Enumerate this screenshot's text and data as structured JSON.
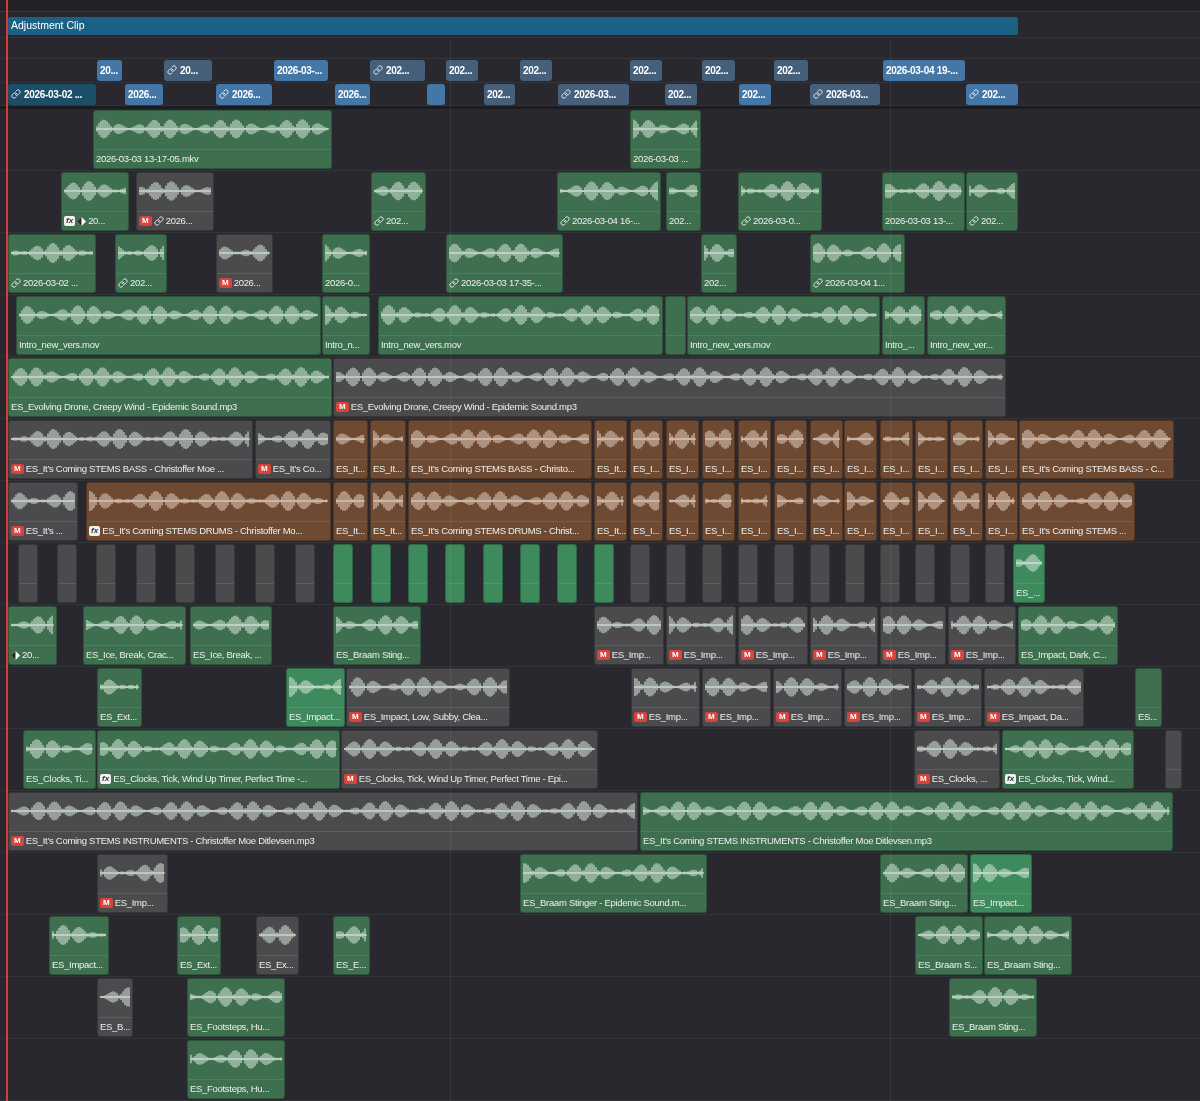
{
  "timeline": {
    "adjustment_clip": {
      "label": "Adjustment Clip"
    },
    "title_tracks": [
      {
        "clips": [
          {
            "label": "20...",
            "color": "#4577a6",
            "linked": false
          },
          {
            "label": "20...",
            "color": "#46607c",
            "linked": true
          },
          {
            "label": "2026-03-...",
            "color": "#4577a6",
            "linked": false
          },
          {
            "label": "202...",
            "color": "#46607c",
            "linked": true
          },
          {
            "label": "202...",
            "color": "#46607c",
            "linked": false
          },
          {
            "label": "202...",
            "color": "#46607c",
            "linked": false
          },
          {
            "label": "202...",
            "color": "#46607c",
            "linked": false
          },
          {
            "label": "202...",
            "color": "#46607c",
            "linked": false
          },
          {
            "label": "202...",
            "color": "#46607c",
            "linked": false
          },
          {
            "label": "2026-03-04 19-...",
            "color": "#4577a6",
            "linked": false
          }
        ]
      },
      {
        "clips": [
          {
            "label": "2026-03-02 ...",
            "color": "#1c4e68",
            "linked": true
          },
          {
            "label": "2026...",
            "color": "#4577a6",
            "linked": false
          },
          {
            "label": "2026...",
            "color": "#4577a6",
            "linked": true
          },
          {
            "label": "2026...",
            "color": "#4577a6",
            "linked": false
          },
          {
            "color": "#4577a6",
            "linked": false
          },
          {
            "label": "202...",
            "color": "#46607c",
            "linked": false
          },
          {
            "label": "2026-03...",
            "color": "#46607c",
            "linked": true
          },
          {
            "label": "202...",
            "color": "#46607c",
            "linked": false
          },
          {
            "label": "202...",
            "color": "#4577a6",
            "linked": false
          },
          {
            "label": "2026-03...",
            "color": "#46607c",
            "linked": true
          },
          {
            "label": "202...",
            "color": "#4577a6",
            "linked": true
          }
        ]
      }
    ],
    "tracks": [
      {
        "clips": [
          {
            "label": "2026-03-03 13-17-05.mkv",
            "color": "#3e7050",
            "linked": false
          },
          {
            "label": "2026-03-03 ...",
            "color": "#3e7050",
            "linked": false
          }
        ]
      },
      {
        "clips": [
          {
            "label": "20...",
            "color": "#3e7050",
            "linked": false,
            "fx_badge": "fx",
            "keyframed": true
          },
          {
            "label": "2026...",
            "color": "#4b4b4e",
            "linked": true,
            "mute_badge": "M",
            "keyframed": false
          },
          {
            "label": "202...",
            "color": "#3e7050",
            "linked": true,
            "keyframed": false
          },
          {
            "label": "2026-03-04 16-...",
            "color": "#3e7050",
            "linked": true,
            "keyframed": false
          },
          {
            "label": "202...",
            "color": "#3e7050",
            "linked": false,
            "keyframed": false
          },
          {
            "label": "2026-03-0...",
            "color": "#3e7050",
            "linked": true,
            "keyframed": false
          },
          {
            "label": "2026-03-03 13-...",
            "color": "#3e7050",
            "linked": false,
            "keyframed": false
          },
          {
            "label": "202...",
            "color": "#3e7050",
            "linked": true,
            "keyframed": false
          }
        ]
      },
      {
        "clips": [
          {
            "label": "2026-03-02 ...",
            "color": "#3e7050",
            "linked": true
          },
          {
            "label": "202...",
            "color": "#3e7050",
            "linked": true
          },
          {
            "label": "2026...",
            "color": "#4b4b4e",
            "linked": false,
            "mute_badge": "M"
          },
          {
            "label": "2026-0...",
            "color": "#3e7050",
            "linked": false
          },
          {
            "label": "2026-03-03 17-35-...",
            "color": "#3e7050",
            "linked": true
          },
          {
            "label": "202...",
            "color": "#3e7050",
            "linked": false
          },
          {
            "label": "2026-03-04 1...",
            "color": "#3e7050",
            "linked": true
          }
        ]
      },
      {
        "clips": [
          {
            "label": "Intro_new_vers.mov",
            "color": "#3e7050"
          },
          {
            "label": "Intro_n...",
            "color": "#3e7050"
          },
          {
            "label": "Intro_new_vers.mov",
            "color": "#3e7050"
          },
          {
            "color": "#3e7050"
          },
          {
            "label": "Intro_new_vers.mov",
            "color": "#3e7050"
          },
          {
            "label": "Intro_...",
            "color": "#3e7050"
          },
          {
            "label": "Intro_new_ver...",
            "color": "#3e7050"
          }
        ]
      },
      {
        "clips": [
          {
            "label": "ES_Evolving Drone, Creepy Wind - Epidemic Sound.mp3",
            "color": "#3e7050"
          },
          {
            "label": "ES_Evolving Drone, Creepy Wind - Epidemic Sound.mp3",
            "color": "#4b4b4e",
            "mute_badge": "M"
          }
        ]
      },
      {
        "clips": [
          {
            "label": "ES_It’s Coming STEMS BASS - Christoffer Moe ...",
            "color": "#4b4b4e",
            "mute_badge": "M"
          },
          {
            "label": "ES_It’s Co...",
            "color": "#4b4b4e",
            "mute_badge": "M"
          },
          {
            "label": "ES_It...",
            "color": "#6e4a33"
          },
          {
            "label": "ES_It...",
            "color": "#6e4a33"
          },
          {
            "label": "ES_It’s Coming STEMS BASS - Christo...",
            "color": "#6e4a33"
          },
          {
            "label": "ES_It...",
            "color": "#6e4a33"
          },
          {
            "label": "ES_I...",
            "color": "#6e4a33"
          },
          {
            "label": "ES_I...",
            "color": "#6e4a33"
          },
          {
            "label": "ES_I...",
            "color": "#6e4a33"
          },
          {
            "label": "ES_I...",
            "color": "#6e4a33"
          },
          {
            "label": "ES_I...",
            "color": "#6e4a33"
          },
          {
            "label": "ES_I...",
            "color": "#6e4a33"
          },
          {
            "label": "ES_I...",
            "color": "#6e4a33"
          },
          {
            "label": "ES_I...",
            "color": "#6e4a33"
          },
          {
            "label": "ES_I...",
            "color": "#6e4a33"
          },
          {
            "label": "ES_I...",
            "color": "#6e4a33"
          },
          {
            "label": "ES_I...",
            "color": "#6e4a33"
          },
          {
            "label": "ES_It’s Coming STEMS BASS - C...",
            "color": "#6e4a33"
          }
        ]
      },
      {
        "clips": [
          {
            "label": "ES_It’s ...",
            "color": "#4b4b4e",
            "mute_badge": "M"
          },
          {
            "label": "ES_It’s Coming STEMS DRUMS - Christoffer Mo...",
            "color": "#6e4a33",
            "fx_badge": "fx"
          },
          {
            "label": "ES_It...",
            "color": "#6e4a33"
          },
          {
            "label": "ES_It...",
            "color": "#6e4a33"
          },
          {
            "label": "ES_It’s Coming STEMS DRUMS - Christ...",
            "color": "#6e4a33"
          },
          {
            "label": "ES_It...",
            "color": "#6e4a33"
          },
          {
            "label": "ES_I...",
            "color": "#6e4a33"
          },
          {
            "label": "ES_I...",
            "color": "#6e4a33"
          },
          {
            "label": "ES_I...",
            "color": "#6e4a33"
          },
          {
            "label": "ES_I...",
            "color": "#6e4a33"
          },
          {
            "label": "ES_I...",
            "color": "#6e4a33"
          },
          {
            "label": "ES_I...",
            "color": "#6e4a33"
          },
          {
            "label": "ES_I...",
            "color": "#6e4a33"
          },
          {
            "label": "ES_I...",
            "color": "#6e4a33"
          },
          {
            "label": "ES_I...",
            "color": "#6e4a33"
          },
          {
            "label": "ES_I...",
            "color": "#6e4a33"
          },
          {
            "label": "ES_I...",
            "color": "#6e4a33"
          },
          {
            "label": "ES_It’s Coming STEMS ...",
            "color": "#6e4a33"
          }
        ]
      },
      {
        "clips": [
          {
            "color": "#4b4b4e"
          },
          {
            "color": "#4b4b4e"
          },
          {
            "color": "#4b4b4e"
          },
          {
            "color": "#4b4b4e"
          },
          {
            "color": "#4b4b4e"
          },
          {
            "color": "#4b4b4e"
          },
          {
            "color": "#4b4b4e"
          },
          {
            "color": "#4b4b4e"
          },
          {
            "color": "#3e8a5c"
          },
          {
            "color": "#3e8a5c"
          },
          {
            "color": "#3e8a5c"
          },
          {
            "color": "#3e8a5c"
          },
          {
            "color": "#3e8a5c"
          },
          {
            "color": "#3e8a5c"
          },
          {
            "color": "#3e8a5c"
          },
          {
            "color": "#3e8a5c"
          },
          {
            "color": "#4b4b4e"
          },
          {
            "color": "#4b4b4e"
          },
          {
            "color": "#4b4b4e"
          },
          {
            "color": "#4b4b4e"
          },
          {
            "color": "#4b4b4e"
          },
          {
            "color": "#4b4b4e"
          },
          {
            "color": "#4b4b4e"
          },
          {
            "color": "#4b4b4e"
          },
          {
            "color": "#4b4b4e"
          },
          {
            "color": "#4b4b4e"
          },
          {
            "color": "#4b4b4e"
          },
          {
            "label": "ES_...",
            "color": "#3e8a5c"
          }
        ]
      },
      {
        "clips": [
          {
            "label": "20...",
            "color": "#3e7050",
            "keyframed": true
          },
          {
            "label": "ES_Ice, Break, Crac...",
            "color": "#3e7050",
            "keyframed": false
          },
          {
            "label": "ES_Ice, Break, ...",
            "color": "#3e7050",
            "keyframed": false
          },
          {
            "label": "ES_Braam Sting...",
            "color": "#3e7050",
            "keyframed": false
          },
          {
            "label": "ES_Imp...",
            "color": "#4b4b4e",
            "mute_badge": "M",
            "keyframed": false
          },
          {
            "label": "ES_Imp...",
            "color": "#4b4b4e",
            "mute_badge": "M",
            "keyframed": false
          },
          {
            "label": "ES_Imp...",
            "color": "#4b4b4e",
            "mute_badge": "M",
            "keyframed": false
          },
          {
            "label": "ES_Imp...",
            "color": "#4b4b4e",
            "mute_badge": "M",
            "keyframed": false
          },
          {
            "label": "ES_Imp...",
            "color": "#4b4b4e",
            "mute_badge": "M",
            "keyframed": false
          },
          {
            "label": "ES_Imp...",
            "color": "#4b4b4e",
            "mute_badge": "M",
            "keyframed": false
          },
          {
            "label": "ES_Impact, Dark, C...",
            "color": "#3e7050",
            "keyframed": false
          }
        ]
      },
      {
        "clips": [
          {
            "label": "ES_Ext...",
            "color": "#3e7050"
          },
          {
            "label": "ES_Impact...",
            "color": "#3e8a5c"
          },
          {
            "label": "ES_Impact, Low, Subby, Clea...",
            "color": "#4b4b4e",
            "mute_badge": "M"
          },
          {
            "label": "ES_Imp...",
            "color": "#4b4b4e",
            "mute_badge": "M"
          },
          {
            "label": "ES_Imp...",
            "color": "#4b4b4e",
            "mute_badge": "M"
          },
          {
            "label": "ES_Imp...",
            "color": "#4b4b4e",
            "mute_badge": "M"
          },
          {
            "label": "ES_Imp...",
            "color": "#4b4b4e",
            "mute_badge": "M"
          },
          {
            "label": "ES_Imp...",
            "color": "#4b4b4e",
            "mute_badge": "M"
          },
          {
            "label": "ES_Impact, Da...",
            "color": "#4b4b4e",
            "mute_badge": "M"
          },
          {
            "label": "ES...",
            "color": "#3e7050"
          }
        ]
      },
      {
        "clips": [
          {
            "label": "ES_Clocks, Ti...",
            "color": "#3e7050"
          },
          {
            "label": "ES_Clocks, Tick, Wind Up Timer, Perfect Time -...",
            "color": "#3e7050",
            "fx_badge": "fx"
          },
          {
            "label": "ES_Clocks, Tick, Wind Up Timer, Perfect Time - Epi...",
            "color": "#4b4b4e",
            "mute_badge": "M"
          },
          {
            "label": "ES_Clocks, ...",
            "color": "#4b4b4e",
            "mute_badge": "M"
          },
          {
            "label": "ES_Clocks, Tick, Wind...",
            "color": "#3e7050",
            "fx_badge": "fx"
          },
          {
            "color": "#4b4b4e"
          }
        ]
      },
      {
        "clips": [
          {
            "label": "ES_It’s Coming STEMS INSTRUMENTS - Christoffer Moe Ditlevsen.mp3",
            "color": "#4b4b4e",
            "mute_badge": "M"
          },
          {
            "label": "ES_It’s Coming STEMS INSTRUMENTS - Christoffer Moe Ditlevsen.mp3",
            "color": "#3e7050"
          }
        ]
      },
      {
        "clips": [
          {
            "label": "ES_Imp...",
            "color": "#4b4b4e",
            "mute_badge": "M"
          },
          {
            "label": "ES_Braam Stinger - Epidemic Sound.m...",
            "color": "#3e7050"
          },
          {
            "label": "ES_Braam Sting...",
            "color": "#3e7050"
          },
          {
            "label": "ES_Impact...",
            "color": "#3e8a5c"
          }
        ]
      },
      {
        "clips": [
          {
            "label": "ES_Impact...",
            "color": "#3e7050"
          },
          {
            "label": "ES_Ext...",
            "color": "#3e7050"
          },
          {
            "label": "ES_Ex...",
            "color": "#4b4b4e"
          },
          {
            "label": "ES_E...",
            "color": "#3e7050"
          },
          {
            "label": "ES_Braam S...",
            "color": "#3e7050"
          },
          {
            "label": "ES_Braam Sting...",
            "color": "#3e7050"
          }
        ]
      },
      {
        "clips": [
          {
            "label": "ES_B...",
            "color": "#4b4b4e"
          },
          {
            "label": "ES_Footsteps, Hu...",
            "color": "#3e7050"
          },
          {
            "label": "ES_Braam Sting...",
            "color": "#3e7050"
          }
        ]
      },
      {
        "clips": [
          {
            "label": "ES_Footsteps, Hu...",
            "color": "#3e7050"
          }
        ]
      }
    ]
  }
}
